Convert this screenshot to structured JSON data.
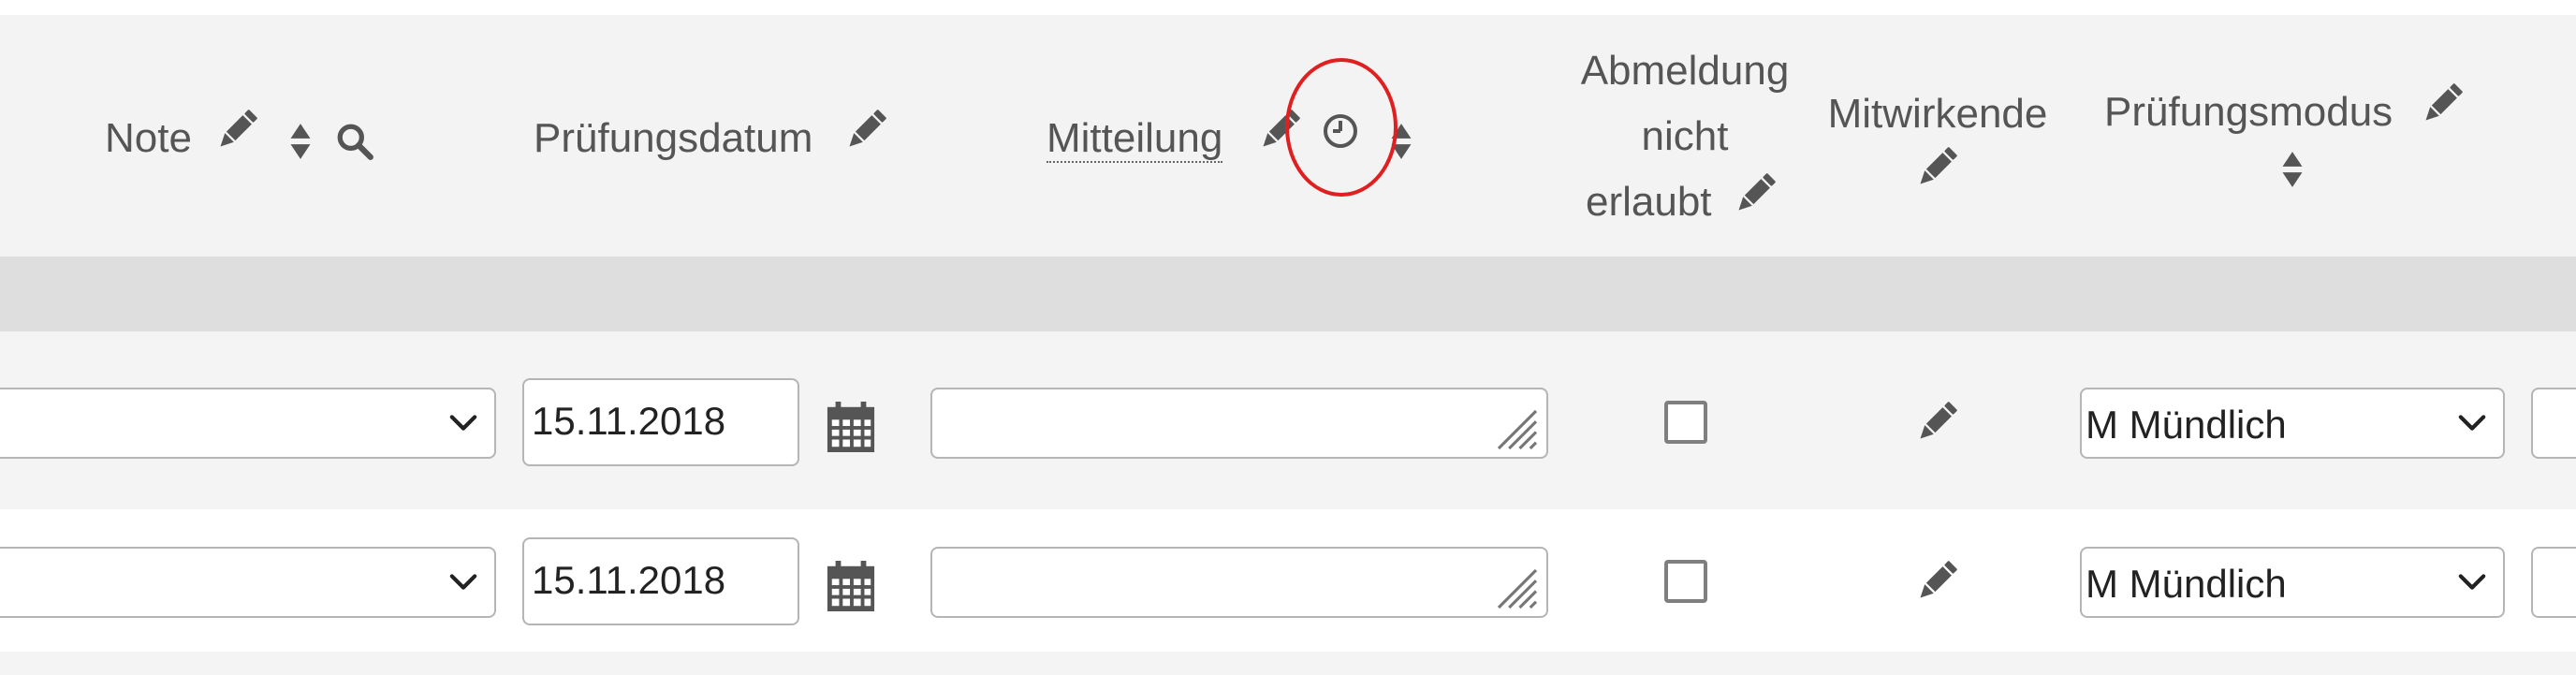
{
  "headers": {
    "note": "Note",
    "pruefungsdatum": "Prüfungsdatum",
    "mitteilung": "Mitteilung",
    "abmeldung_line1": "Abmeldung",
    "abmeldung_line2": "nicht",
    "abmeldung_line3": "erlaubt",
    "mitwirkende": "Mitwirkende",
    "pruefungsmodus": "Prüfungsmodus"
  },
  "rows": [
    {
      "date": "15.11.2018",
      "modus": "M Mündlich",
      "abmeldung_checked": false
    },
    {
      "date": "15.11.2018",
      "modus": "M Mündlich",
      "abmeldung_checked": false
    }
  ],
  "icons": {
    "edit": "pencil-icon",
    "sort": "sort-icon",
    "search": "search-icon",
    "calendar": "calendar-icon",
    "history": "clock-icon",
    "dropdown": "chevron-down-icon",
    "resize": "resize-handle-icon"
  },
  "colors": {
    "header_bg": "#f3f3f3",
    "group_row_bg": "#dedede",
    "row_alt_bg": "#f4f4f4",
    "text": "#555555",
    "highlight": "#e02020"
  }
}
